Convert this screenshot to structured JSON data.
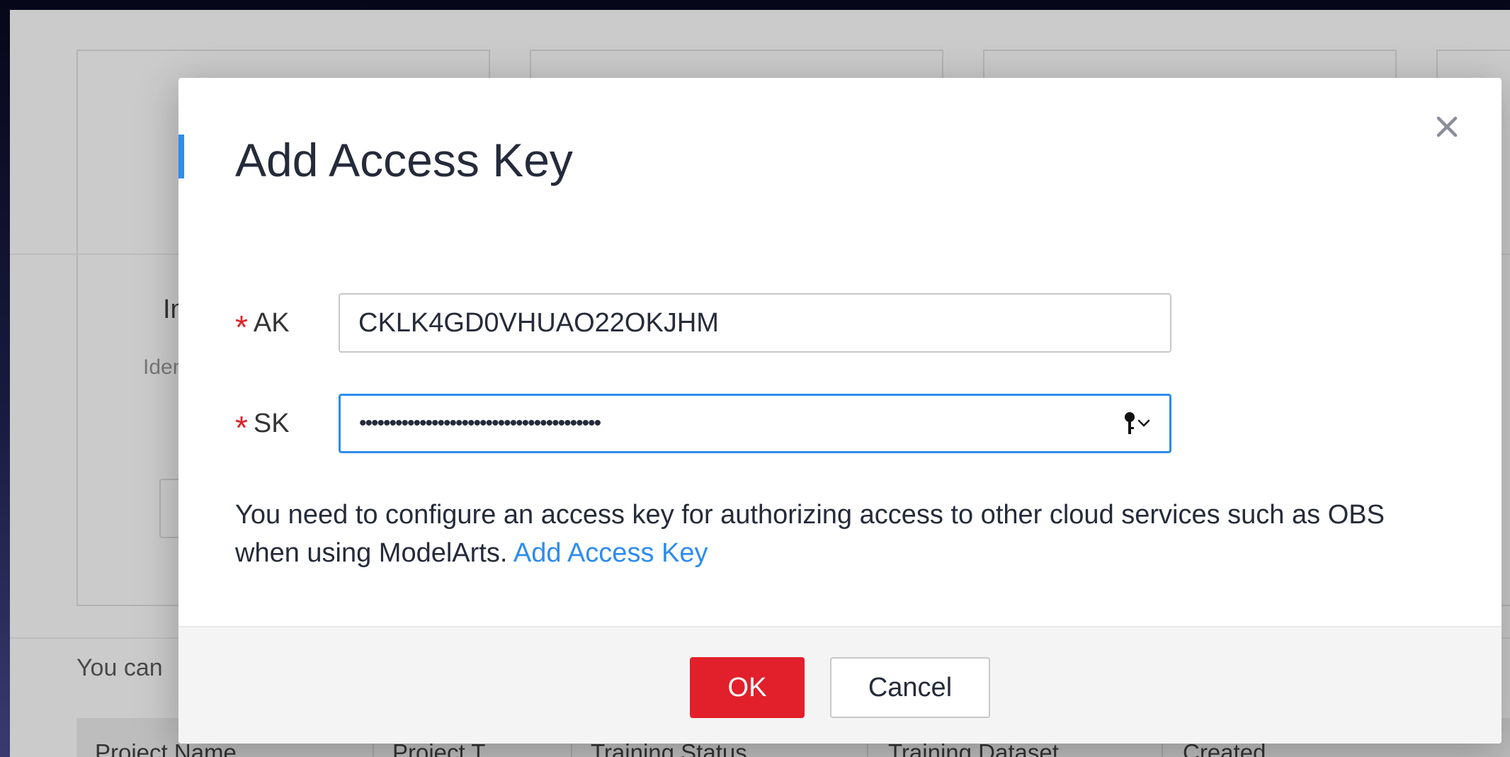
{
  "background": {
    "card_snippet_1": "In",
    "card_snippet_2": "Iden",
    "hint_snippet": "You can",
    "table_headers": [
      "Project Name",
      "Project T...",
      "Training Status",
      "Training Dataset",
      "Created"
    ]
  },
  "dialog": {
    "title": "Add Access Key",
    "accent_color": "#2d8cf0",
    "close_icon": "close-icon",
    "fields": {
      "ak": {
        "label": "AK",
        "required_mark": "*",
        "value": "CKLK4GD0VHUAO22OKJHM"
      },
      "sk": {
        "label": "SK",
        "required_mark": "*",
        "masked_value": "••••••••••••••••••••••••••••••••••••••••",
        "icon": "key-icon"
      }
    },
    "info": {
      "text": "You need to configure an access key for authorizing access to other cloud services such as OBS when using ModelArts.",
      "link_text": "Add Access Key"
    },
    "buttons": {
      "ok_label": "OK",
      "ok_color": "#e1202b",
      "cancel_label": "Cancel"
    }
  }
}
